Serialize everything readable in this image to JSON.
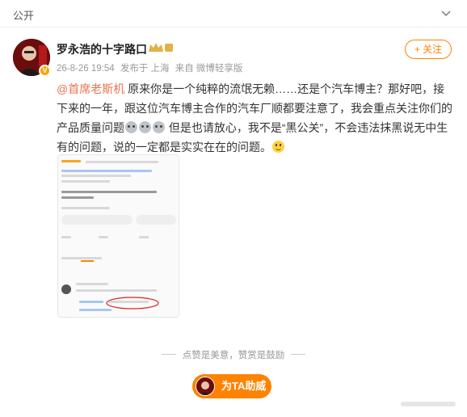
{
  "topbar": {
    "visibility_label": "公开",
    "chevron_icon": "chevron-down-icon"
  },
  "post": {
    "author": "罗永浩的十字路口",
    "verified_badge": "V",
    "timestamp": "26-8-26 19:54",
    "location": "发布于 上海",
    "source": "来自 微博轻享版",
    "follow_label": "+ 关注",
    "content": {
      "mention": "@首席老斯机",
      "text1": " 原来你是一个纯粹的流氓无赖……还是个汽车博主？那好吧，接下来的一年，跟这位汽车博主合作的汽车厂顺都要注意了，我会重点关注你们的产品质量问题",
      "text2": " 但是也请放心，我不是“黑公关”，不会违法抹黑说无中生有的问题，说的一定都是实实在在的问题。"
    }
  },
  "footer": {
    "divider_text": "点赞是美意，赞赏是鼓励",
    "support_label": "为TA助威"
  },
  "colors": {
    "accent": "#ff8200",
    "mention": "#eb7350",
    "meta": "#999999"
  }
}
